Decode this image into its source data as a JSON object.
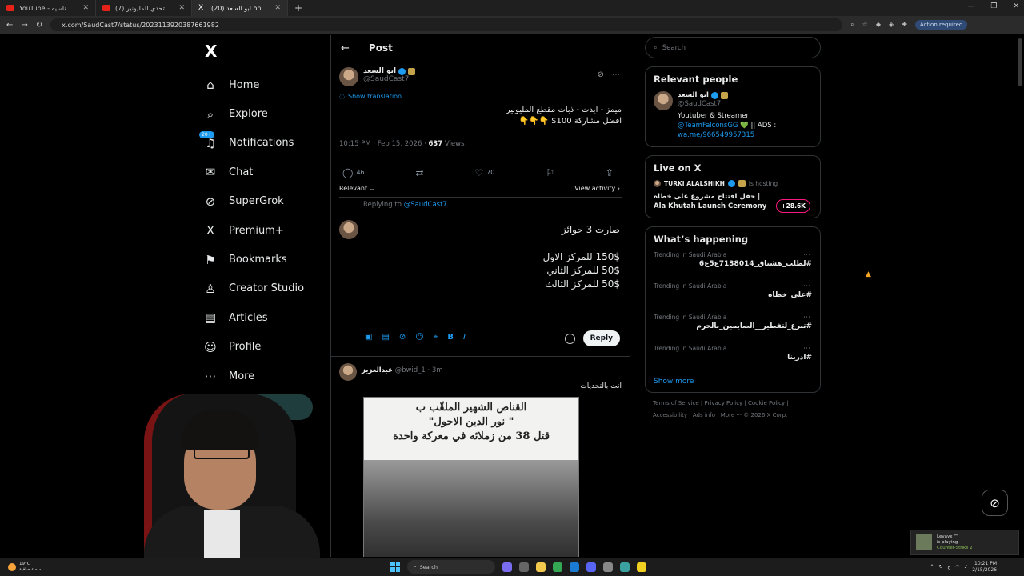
{
  "browser": {
    "tabs": [
      {
        "title": "YouTube - ما طلبك ناسيه"
      },
      {
        "title": "(7) تحدي المليونير YouTube 2 - "
      },
      {
        "title": "(20) ابو السعد on X \"ميمز - ايدت"
      }
    ],
    "new_tab": "+",
    "url": "x.com/SaudCast7/status/2023113920387661982",
    "action_required": "Action required"
  },
  "nav": {
    "items": [
      {
        "label": "Home",
        "icon": "⌂"
      },
      {
        "label": "Explore",
        "icon": "⌕"
      },
      {
        "label": "Notifications",
        "icon": "♫",
        "badge": "20+"
      },
      {
        "label": "Chat",
        "icon": "✉"
      },
      {
        "label": "SuperGrok",
        "icon": "⊘"
      },
      {
        "label": "Premium+",
        "icon": "X"
      },
      {
        "label": "Bookmarks",
        "icon": "⚑"
      },
      {
        "label": "Creator Studio",
        "icon": "♙"
      },
      {
        "label": "Articles",
        "icon": "▤"
      },
      {
        "label": "Profile",
        "icon": "☺"
      },
      {
        "label": "More",
        "icon": "⋯"
      }
    ],
    "post_button": "t"
  },
  "post": {
    "header_title": "Post",
    "author_name": "ابو السعد",
    "author_handle": "@SaudCast7",
    "show_translation": "Show translation",
    "text_line1": "ميمز - ايدت - ذبات مقطع المليونير",
    "text_line2": "افضل مشاركة 100$ 👇👇👇",
    "time": "10:15 PM · Feb 15, 2026 · ",
    "views_count": "637",
    "views_label": " Views",
    "replies": "46",
    "likes": "70",
    "sort_label": "Relevant",
    "view_activity": "View activity"
  },
  "composer": {
    "replying_prefix": "Replying to ",
    "replying_handle": "@SaudCast7",
    "line1": "صارت 3 جوائز",
    "line2": "150$ للمركز الاول",
    "line3": "50$ للمركز الثاني",
    "line4": "50$ للمركز الثالث",
    "reply_button": "Reply"
  },
  "reply": {
    "name": "عبدالعزيز",
    "handle": "@bwid_1",
    "time": "· 3m",
    "text": "انت بالتحديات",
    "image_caption1": "القناص الشهير الملقّب ب",
    "image_caption2": "\" نور الدين الاحول\"",
    "image_caption3": "قتل 38 من زملائه في معركة واحدة"
  },
  "sidebar": {
    "search_placeholder": "Search",
    "relevant_title": "Relevant people",
    "rp_name": "ابو السعد",
    "rp_handle": "@SaudCast7",
    "rp_bio1": "Youtuber & Streamer",
    "rp_bio2_link": "@TeamFalconsGG",
    "rp_bio2_rest": " 💚 || ADS :",
    "rp_bio3_link": "wa.me/966549957315",
    "live_title": "Live on X",
    "live_host_name": "TURKI ALALSHIKH",
    "live_host_suffix": "is hosting",
    "live_event": "حفل افتتاح مشروع على خطاه | Ala Khutah Launch Ceremony",
    "live_count": "+28.6K",
    "happening_title": "What’s happening",
    "trends": [
      {
        "context": "Trending in Saudi Arabia",
        "tag": "#لطلب_هشتاق_7138014ع5ع6"
      },
      {
        "context": "Trending in Saudi Arabia",
        "tag": "#على_خطاه"
      },
      {
        "context": "Trending in Saudi Arabia",
        "tag": "#تبرع_لتفطير__الصايمين_بالحرم"
      },
      {
        "context": "Trending in Saudi Arabia",
        "tag": "#ادرينا"
      }
    ],
    "show_more": "Show more",
    "footer_row1": "Terms of Service  |  Privacy Policy  |  Cookie Policy  |",
    "footer_row2": "Accessibility  |  Ads info  |  More ···  © 2026 X Corp."
  },
  "notification": {
    "user": "Levayx ™",
    "status": "is playing",
    "game": "Counter-Strike 2"
  },
  "taskbar": {
    "weather_temp": "19°C",
    "weather_desc": "سماء صافية",
    "search": "Search",
    "time": "10:21 PM",
    "date": "2/15/2026",
    "lang": "ع"
  }
}
